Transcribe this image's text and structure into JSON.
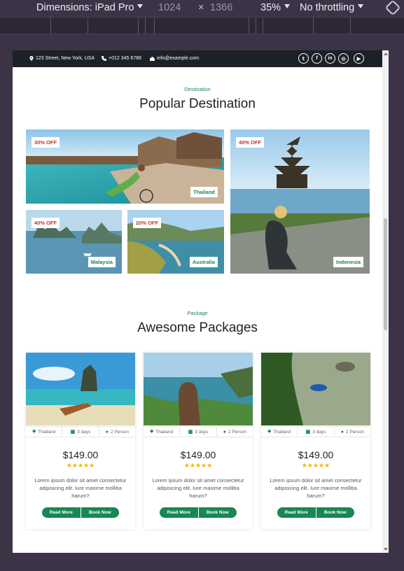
{
  "devtools": {
    "dimensions": "Dimensions: iPad Pro",
    "width": "1024",
    "times": "×",
    "height": "1366",
    "zoom": "35%",
    "throttling": "No throttling"
  },
  "topbar": {
    "address": "123 Street, New York, USA",
    "phone": "+012 345 6789",
    "email": "info@example.com",
    "social_icons": [
      "twitter-icon",
      "facebook-icon",
      "linkedin-icon",
      "instagram-icon",
      "youtube-icon"
    ]
  },
  "destination": {
    "subtitle": "Destination",
    "title": "Popular Destination",
    "items": [
      {
        "place": "Thailand",
        "discount": "30% OFF"
      },
      {
        "place": "Malaysia",
        "discount": "40% OFF"
      },
      {
        "place": "Australia",
        "discount": "20% OFF"
      },
      {
        "place": "Indonesia",
        "discount": "40% OFF"
      }
    ]
  },
  "packages": {
    "subtitle": "Package",
    "title": "Awesome Packages",
    "items": [
      {
        "location": "Thailand",
        "duration": "3 days",
        "persons": "2 Person",
        "price": "$149.00",
        "stars": "★★★★★",
        "description": "Lorem ipsum dolor sit amet consectetur adipisicing elit. Iure maxime mollitia harum?",
        "read_more": "Read More",
        "book_now": "Book Now"
      },
      {
        "location": "Thailand",
        "duration": "3 days",
        "persons": "2 Person",
        "price": "$149.00",
        "stars": "★★★★★",
        "description": "Lorem ipsum dolor sit amet consectetur adipisicing elit. Iure maxime mollitia harum?",
        "read_more": "Read More",
        "book_now": "Book Now"
      },
      {
        "location": "Thailand",
        "duration": "3 days",
        "persons": "2 Person",
        "price": "$149.00",
        "stars": "★★★★★",
        "description": "Lorem ipsum dolor sit amet consectetur adipisicing elit. Iure maxime mollitia harum?",
        "read_more": "Read More",
        "book_now": "Book Now"
      }
    ]
  },
  "colors": {
    "accent": "#198754",
    "topbar": "#1c2127",
    "discount": "#c0392b",
    "star": "#f4b400"
  }
}
